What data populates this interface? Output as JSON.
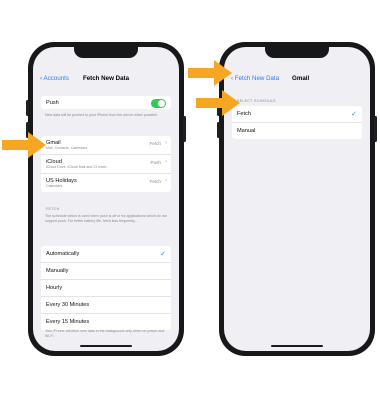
{
  "colors": {
    "accent": "#2f7cf6",
    "toggle_on": "#34c759",
    "arrow": "#f5a623"
  },
  "left_phone": {
    "nav": {
      "back_label": "Accounts",
      "title": "Fetch New Data"
    },
    "push": {
      "label": "Push",
      "enabled": true,
      "footer": "New data will be pushed to your iPhone from the server when possible."
    },
    "accounts": [
      {
        "label": "Gmail",
        "sublabel": "Mail, Contacts, Calendars",
        "value": "Fetch"
      },
      {
        "label": "iCloud",
        "sublabel": "iCloud Drive, iCloud Mail and 11 more...",
        "value": "Push"
      },
      {
        "label": "US Holidays",
        "sublabel": "Calendars",
        "value": "Fetch"
      }
    ],
    "fetch_header": "FETCH",
    "fetch_footer": "The schedule below is used when push is off or for applications which do not support push. For better battery life, fetch less frequently.",
    "schedule": [
      {
        "label": "Automatically",
        "selected": true
      },
      {
        "label": "Manually",
        "selected": false
      },
      {
        "label": "Hourly",
        "selected": false
      },
      {
        "label": "Every 30 Minutes",
        "selected": false
      },
      {
        "label": "Every 15 Minutes",
        "selected": false
      }
    ],
    "bottom_note": "Your iPhone will fetch new data in the background only when on power and Wi-Fi."
  },
  "right_phone": {
    "nav": {
      "back_label": "Fetch New Data",
      "title": "Gmail"
    },
    "header": "SELECT SCHEDULE",
    "options": [
      {
        "label": "Fetch",
        "selected": true
      },
      {
        "label": "Manual",
        "selected": false
      }
    ]
  },
  "icons": {
    "back": "chevron-left-icon",
    "disclosure": "chevron-right-icon",
    "check": "checkmark-icon"
  }
}
